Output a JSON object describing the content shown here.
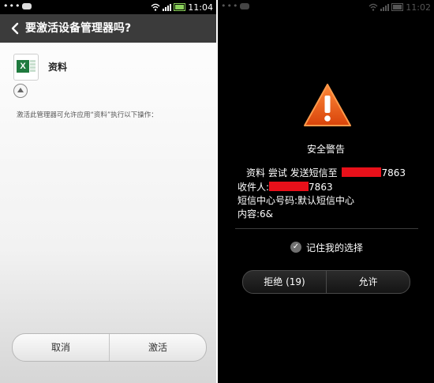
{
  "left": {
    "status": {
      "dots": "•••",
      "time": "11:04"
    },
    "header": {
      "title": "要激活设备管理器吗?"
    },
    "app": {
      "icon_label": "X",
      "name": "资料"
    },
    "description": "激活此管理器可允许应用“资料”执行以下操作：",
    "buttons": {
      "cancel": "取消",
      "activate": "激活"
    }
  },
  "right": {
    "status": {
      "dots": "•••",
      "time": "11:02"
    },
    "warning_title": "安全警告",
    "message": {
      "line1_prefix": "资料 尝试 发送短信至",
      "line1_suffix": "7863",
      "line2_prefix": "收件人:",
      "line2_suffix": "7863",
      "line3": "短信中心号码:默认短信中心",
      "line4": "内容:6&"
    },
    "remember_label": "记住我的选择",
    "buttons": {
      "deny": "拒绝 (19)",
      "allow": "允许"
    }
  },
  "colors": {
    "redaction": "#e8101a",
    "warning": "#e85a10",
    "excel_green": "#1f7a3e"
  },
  "icons": [
    "back-icon",
    "excel-icon",
    "collapse-icon",
    "wifi-icon",
    "signal-icon",
    "battery-icon",
    "warning-icon",
    "check-icon"
  ]
}
